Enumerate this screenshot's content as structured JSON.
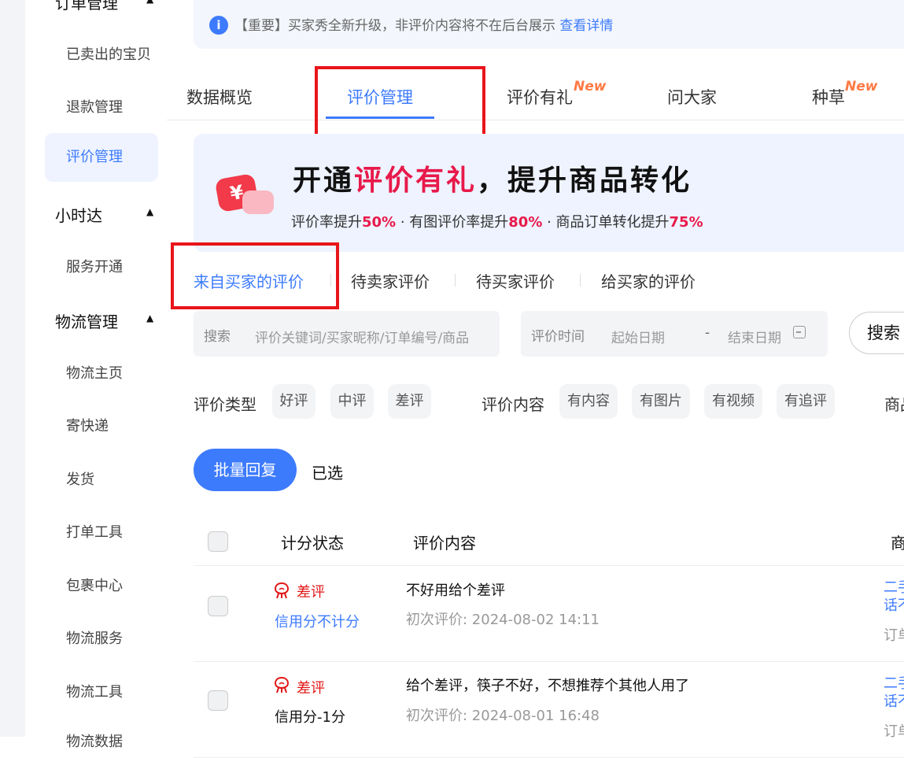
{
  "sidebar": {
    "top_group": "订单管理",
    "items_order": [
      "已卖出的宝贝",
      "退款管理",
      "评价管理"
    ],
    "group_xiaoshida": "小时达",
    "items_xiaoshida": [
      "服务开通"
    ],
    "group_logistics": "物流管理",
    "items_logistics": [
      "物流主页",
      "寄快递",
      "发货",
      "打单工具",
      "包裹中心",
      "物流服务",
      "物流工具",
      "物流数据"
    ],
    "active_item": "评价管理"
  },
  "notice": {
    "text": "【重要】买家秀全新升级，非评价内容将不在后台展示",
    "link": "查看详情",
    "icon": "info-icon"
  },
  "tabs": {
    "items": [
      "数据概览",
      "评价管理",
      "评价有礼",
      "问大家",
      "种草"
    ],
    "new_badge": "New",
    "active": "评价管理"
  },
  "banner": {
    "title_prefix": "开通",
    "title_highlight": "评价有礼",
    "title_suffix": "，提升商品转化",
    "sub": {
      "p1": "评价率提升",
      "v1": "50%",
      "p2": " · 有图评价率提升",
      "v2": "80%",
      "p3": " · 商品订单转化提升",
      "v3": "75%"
    },
    "icon_symbol": "¥"
  },
  "subtabs": {
    "items": [
      "来自买家的评价",
      "待卖家评价",
      "待买家评价",
      "给买家的评价"
    ],
    "active": "来自买家的评价"
  },
  "search": {
    "label": "搜索",
    "placeholder": "评价关键词/买家昵称/订单编号/商品"
  },
  "date_filter": {
    "label": "评价时间",
    "start": "起始日期",
    "separator": "-",
    "end": "结束日期"
  },
  "search_button": "搜索",
  "filters": {
    "type_label": "评价类型",
    "types": [
      "好评",
      "中评",
      "差评"
    ],
    "content_label": "评价内容",
    "contents": [
      "有内容",
      "有图片",
      "有视频",
      "有追评"
    ],
    "product_label_cut": "商品"
  },
  "actions": {
    "batch_reply": "批量回复",
    "selected": "已选"
  },
  "table": {
    "headers": [
      "计分状态",
      "评价内容",
      "商品"
    ],
    "rows": [
      {
        "rating": "差评",
        "credit": "信用分不计分",
        "content": "不好用给个差评",
        "time": "初次评价: 2024-08-02 14:11",
        "product_line1": "二手",
        "product_line2": "话不",
        "order": "订单"
      },
      {
        "rating": "差评",
        "credit": "信用分-1分",
        "content": "给个差评，筷子不好，不想推荐个其他人用了",
        "time": "初次评价: 2024-08-01 16:48",
        "product_line1": "二手",
        "product_line2": "话不",
        "order": "订单"
      }
    ]
  },
  "colors": {
    "accent": "#3d7bfd",
    "negative": "#e21818",
    "highlight": "#e8194a",
    "annotation_box": "#e8151b",
    "credit_link": "#3d7bfd",
    "credit_plain": "#111111"
  }
}
